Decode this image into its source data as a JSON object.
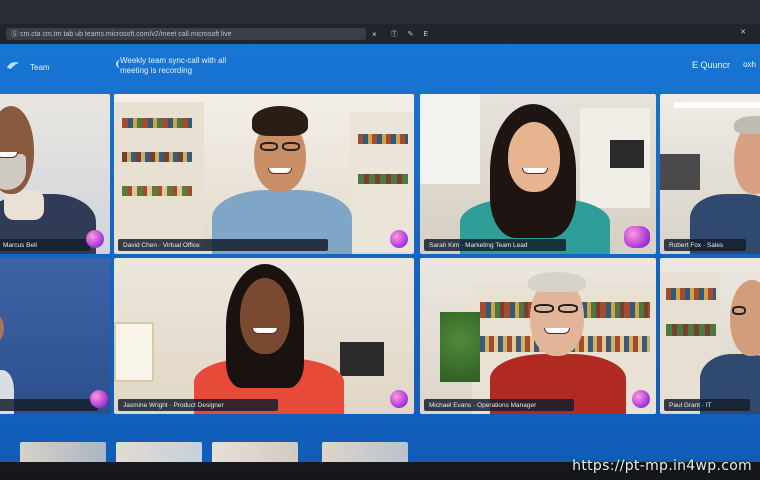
{
  "browser": {
    "address_text": "Ⓢ cm.cta cm.tm tab ub teams.microsoft.com/v2/meet call.microsoft live",
    "address_close": "×",
    "tab_icon_label": "Ⓣ",
    "tab_pin": "✎",
    "tab_label": "E",
    "window_close": "✕"
  },
  "app": {
    "name": "Team",
    "meeting_title_line1": "Weekly team sync-call with all",
    "meeting_title_line2": "meeting is recording",
    "participants_label": "E Quuncr",
    "more_label": "oxh"
  },
  "participants": [
    {
      "name": "Marcus Bell",
      "tile": "tile-1"
    },
    {
      "name": "David Chen · Virtual Office",
      "tile": "tile-2"
    },
    {
      "name": "Sarah Kim · Marketing Team Lead",
      "tile": "tile-3"
    },
    {
      "name": "Robert Fox · Sales",
      "tile": "tile-4"
    },
    {
      "name": "",
      "tile": "tile-5"
    },
    {
      "name": "Jasmine Wright · Product Designer",
      "tile": "tile-6"
    },
    {
      "name": "Michael Evans · Operations Manager",
      "tile": "tile-7"
    },
    {
      "name": "Paul Grant · IT",
      "tile": "tile-8"
    }
  ],
  "colors": {
    "accent": "#1877d6",
    "nameplate": "#141e2d",
    "reaction": "#b03ee0"
  },
  "icons": [
    "teams-logo-icon",
    "calendar-icon",
    "reaction-icon",
    "close-icon",
    "pin-icon",
    "leave-icon"
  ],
  "watermark": "https://pt-mp.in4wp.com"
}
